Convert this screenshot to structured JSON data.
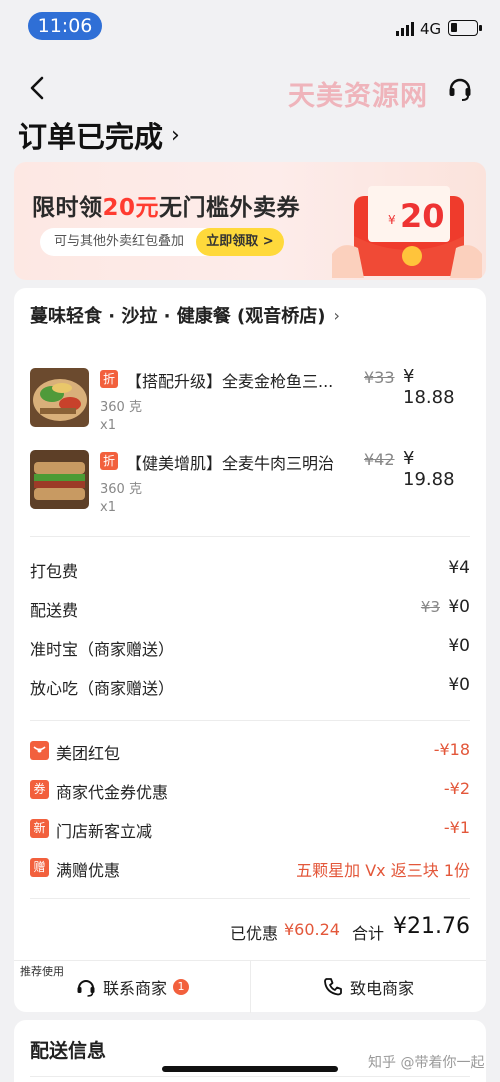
{
  "status_bar": {
    "time": "11:06",
    "network": "4G",
    "battery_level": 0.25
  },
  "watermark_top": "天美资源网",
  "page_title": "订单已完成",
  "banner": {
    "title_prefix": "限时领",
    "title_amount": "20元",
    "title_suffix": "无门槛外卖券",
    "subtitle": "可与其他外卖红包叠加",
    "button": "立即领取 >",
    "envelope_currency": "¥",
    "envelope_amount": "20"
  },
  "order": {
    "shop_name": "蔓味轻食 · 沙拉 · 健康餐 (观音桥店)",
    "items": [
      {
        "tag": "折",
        "name": "【搭配升级】全麦金枪鱼三...",
        "orig_price": "¥33",
        "price": "¥ 18.88",
        "spec": "360 克",
        "qty": "x1"
      },
      {
        "tag": "折",
        "name": "【健美增肌】全麦牛肉三明治",
        "orig_price": "¥42",
        "price": "¥ 19.88",
        "spec": "360 克",
        "qty": "x1"
      }
    ],
    "fees": [
      {
        "label": "打包费",
        "orig": "",
        "value": "¥4"
      },
      {
        "label": "配送费",
        "orig": "¥3",
        "value": "¥0"
      },
      {
        "label": "准时宝（商家赠送）",
        "orig": "",
        "value": "¥0"
      },
      {
        "label": "放心吃（商家赠送）",
        "orig": "",
        "value": "¥0"
      }
    ],
    "promos": [
      {
        "icon": "",
        "label": "美团红包",
        "value": "-¥18"
      },
      {
        "icon": "券",
        "label": "商家代金券优惠",
        "value": "-¥2"
      },
      {
        "icon": "新",
        "label": "门店新客立减",
        "value": "-¥1"
      },
      {
        "icon": "赠",
        "label": "满赠优惠",
        "value": "五颗星加 Vx 返三块 1份"
      }
    ],
    "saved_label": "已优惠",
    "saved_amount": "¥60.24",
    "total_label": "合计",
    "total_amount": "¥21.76"
  },
  "actions": {
    "recommend_label": "推荐使用",
    "contact_merchant": "联系商家",
    "contact_badge": "1",
    "call_merchant": "致电商家"
  },
  "delivery": {
    "title": "配送信息"
  },
  "watermark_bottom": "知乎 @带着你一起",
  "colors": {
    "accent": "#f2603d",
    "discount_red": "#e3573a",
    "time_pill": "#2f6fd6",
    "claim_yellow": "#ffd93b"
  }
}
